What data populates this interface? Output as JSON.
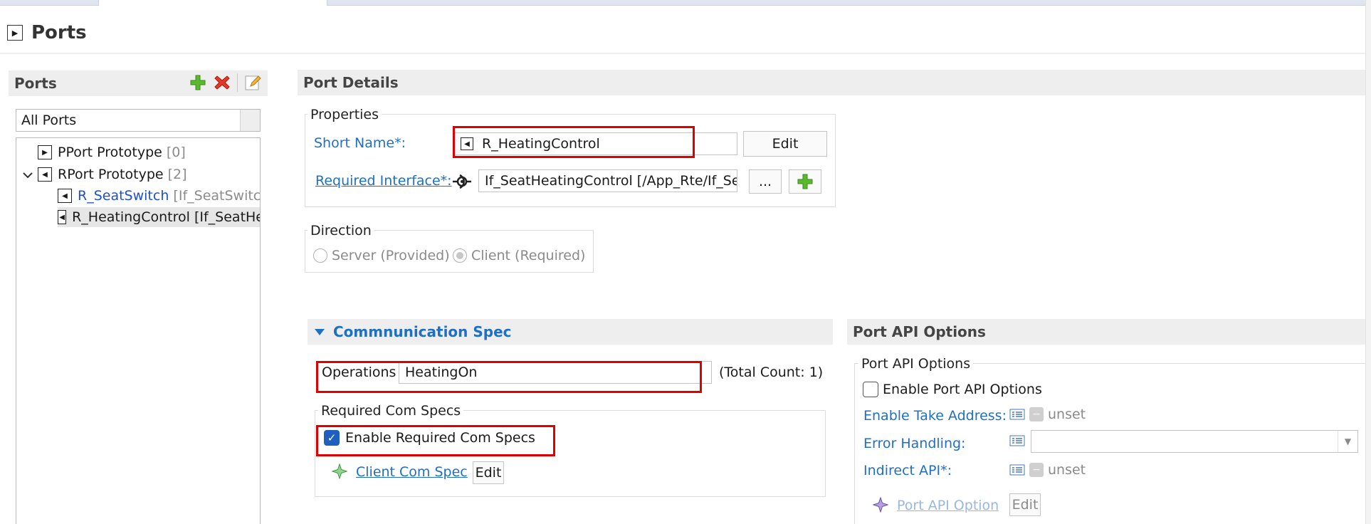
{
  "page": {
    "title": "Ports"
  },
  "ports_panel": {
    "title": "Ports",
    "filter_value": "All Ports",
    "tree": [
      {
        "label": "PPort Prototype",
        "count": "[0]"
      },
      {
        "label": "RPort Prototype",
        "count": "[2]"
      },
      {
        "label": "R_SeatSwitch",
        "suffix": "[If_SeatSwitch"
      },
      {
        "label": "R_HeatingControl",
        "suffix": "[If_SeatHe"
      }
    ]
  },
  "details": {
    "title": "Port Details",
    "properties": {
      "group_title": "Properties",
      "short_name_label": "Short Name*:",
      "short_name_value": "R_HeatingControl",
      "edit_label": "Edit",
      "required_interface_label": "Required Interface*:",
      "required_interface_value": "If_SeatHeatingControl [/App_Rte/If_Sea",
      "browse_label": "..."
    },
    "direction": {
      "group_title": "Direction",
      "server_label": "Server (Provided)",
      "client_label": "Client (Required)",
      "selected": "Client (Required)"
    }
  },
  "communication_spec": {
    "title": "Commnunication Spec",
    "operations_label": "Operations",
    "operations_value": "HeatingOn",
    "total_count": "(Total Count: 1)",
    "required_com_specs": {
      "group_title": "Required Com Specs",
      "enable_label": "Enable Required Com Specs",
      "enabled": true,
      "client_com_spec_label": "Client Com Spec",
      "edit_label": "Edit"
    }
  },
  "port_api": {
    "title": "Port API Options",
    "group_title": "Port API Options",
    "enable_label": "Enable Port API Options",
    "enabled": false,
    "take_address_label": "Enable Take Address:",
    "take_address_value": "unset",
    "error_handling_label": "Error Handling:",
    "error_handling_value": "",
    "indirect_api_label": "Indirect API*:",
    "indirect_api_value": "unset",
    "port_api_option_label": "Port API Option",
    "edit_label": "Edit"
  },
  "colors": {
    "link": "#1f6fc5",
    "highlight_red": "#e00000",
    "checkbox_blue": "#1f5fbf",
    "section_gray": "#eeeeee"
  }
}
